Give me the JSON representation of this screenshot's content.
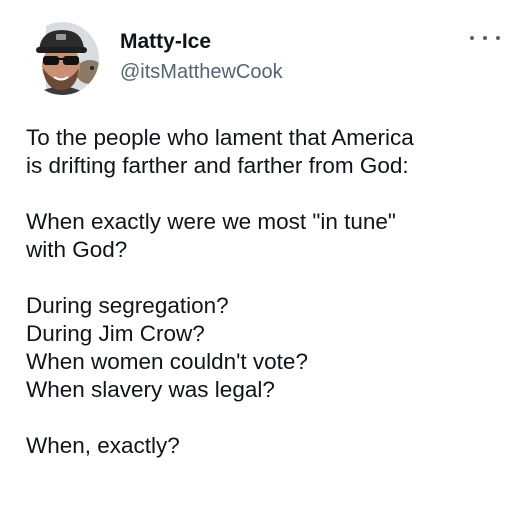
{
  "author": {
    "display_name": "Matty-Ice",
    "handle": "@itsMatthewCook",
    "avatar_icon": "profile-photo"
  },
  "more_icon": "more-horizontal-icon",
  "tweet": {
    "paragraphs": [
      [
        "To the people who lament that America",
        "is drifting farther and farther from God:"
      ],
      [
        "When exactly were we most \"in tune\"",
        "with God?"
      ],
      [
        "During segregation?",
        "During Jim Crow?",
        "When women couldn't vote?",
        "When slavery was legal?"
      ],
      [
        "When, exactly?"
      ]
    ]
  }
}
